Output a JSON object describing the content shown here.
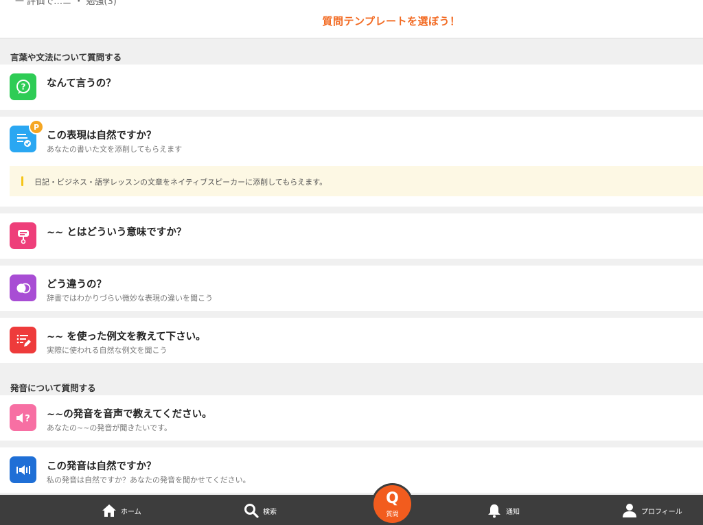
{
  "header": {
    "cut_text": "一 評価で…ニ ・ 勉強(3)",
    "title": "質問テンプレートを選ぼう！"
  },
  "sections": [
    {
      "label": "言葉や文法について質問する",
      "items": [
        {
          "title": "なんて言うの？",
          "subtitle": "",
          "icon": "question-bubble-icon",
          "color": "#2ecc55"
        },
        {
          "title": "この表現は自然ですか？",
          "subtitle": "あなたの書いた文を添削してもらえます",
          "icon": "document-check-icon",
          "color": "#2aa7f2",
          "badge": "P",
          "note": "日記・ビジネス・語学レッスンの文章をネイティブスピーカーに添削してもらえます。"
        },
        {
          "title": "~~ とはどういう意味ですか？",
          "subtitle": "",
          "icon": "meaning-icon",
          "color": "#ee3f7a"
        },
        {
          "title": "どう違うの？",
          "subtitle": "辞書ではわかりづらい微妙な表現の違いを聞こう",
          "icon": "compare-circles-icon",
          "color": "#a84dd4"
        },
        {
          "title": "~~ を使った例文を教えて下さい。",
          "subtitle": "実際に使われる自然な例文を聞こう",
          "icon": "list-pen-icon",
          "color": "#ee3b3b"
        }
      ]
    },
    {
      "label": "発音について質問する",
      "items": [
        {
          "title": "~~の発音を音声で教えてください。",
          "subtitle": "あなたの~~の発音が聞きたいです。",
          "icon": "speaker-question-icon",
          "color": "#f76fa3"
        },
        {
          "title": "この発音は自然ですか？",
          "subtitle": "私の発音は自然ですか？あなたの発音を聞かせてください。",
          "icon": "speaker-wave-icon",
          "color": "#1f6fd6"
        }
      ]
    }
  ],
  "tabbar": {
    "home": "ホーム",
    "search": "検索",
    "question": "質問",
    "question_glyph": "Q",
    "notify": "通知",
    "profile": "プロフィール"
  },
  "colors": {
    "accent": "#f26a22",
    "tabbar_bg": "#3d3d3d",
    "question_button": "#f25c1e"
  }
}
